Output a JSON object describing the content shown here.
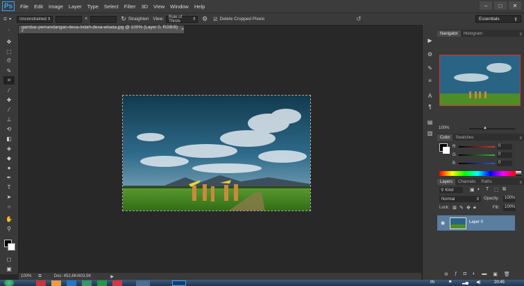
{
  "app": {
    "logo": "Ps",
    "menu": [
      "File",
      "Edit",
      "Image",
      "Layer",
      "Type",
      "Select",
      "Filter",
      "3D",
      "View",
      "Window",
      "Help"
    ],
    "window_controls": [
      "–",
      "□",
      "✕"
    ]
  },
  "options_bar": {
    "ratio_value": "Unconstrained",
    "ratio_swap": "×",
    "straighten_label": "Straighten",
    "view_label": "View:",
    "view_value": "Rule of Thirds",
    "delete_cropped_label": "Delete Cropped Pixels",
    "delete_cropped_checked": true,
    "workspace": "Essentials"
  },
  "document": {
    "tab_title": "gambar-pemandangan-desa-indah-desa-wisata.jpg @ 100% (Layer 0, RGB/8) *",
    "zoom": "100%",
    "doc_size": "Doc: 452,6K/603,5K"
  },
  "navigator": {
    "tabs": [
      "Navigator",
      "Histogram"
    ],
    "zoom": "100%"
  },
  "color_panel": {
    "tabs": [
      "Color",
      "Swatches"
    ],
    "channels": [
      {
        "label": "R",
        "value": "0",
        "color": "#d03030"
      },
      {
        "label": "G",
        "value": "0",
        "color": "#30b030"
      },
      {
        "label": "B",
        "value": "0",
        "color": "#3050d0"
      }
    ]
  },
  "layers_panel": {
    "tabs": [
      "Layers",
      "Channels",
      "Paths"
    ],
    "kind_label": "Kind",
    "blend_mode": "Normal",
    "opacity_label": "Opacity:",
    "opacity_value": "100%",
    "lock_label": "Lock:",
    "fill_label": "Fill:",
    "fill_value": "100%",
    "layers": [
      {
        "name": "Layer 0",
        "visible": true
      }
    ]
  },
  "taskbar": {
    "lang": "IN",
    "time": "20:45"
  }
}
